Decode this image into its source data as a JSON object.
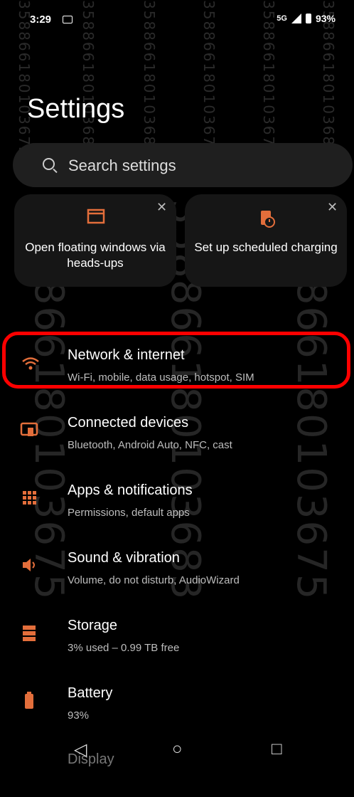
{
  "status_bar": {
    "time": "3:29",
    "network": "5G",
    "battery": "93%"
  },
  "page": {
    "title": "Settings"
  },
  "search": {
    "placeholder": "Search settings"
  },
  "suggestions": [
    {
      "label": "Open floating windows via heads-ups"
    },
    {
      "label": "Set up scheduled charging"
    }
  ],
  "items": [
    {
      "title": "Network & internet",
      "subtitle": "Wi-Fi, mobile, data usage, hotspot, SIM"
    },
    {
      "title": "Connected devices",
      "subtitle": "Bluetooth, Android Auto, NFC, cast"
    },
    {
      "title": "Apps & notifications",
      "subtitle": "Permissions, default apps"
    },
    {
      "title": "Sound & vibration",
      "subtitle": "Volume, do not disturb, AudioWizard"
    },
    {
      "title": "Storage",
      "subtitle": "3% used – 0.99 TB free"
    },
    {
      "title": "Battery",
      "subtitle": "93%"
    },
    {
      "title": "Display",
      "subtitle": ""
    }
  ],
  "watermark": {
    "text": "358866180103675",
    "text2": "358866180103683"
  },
  "accent_color": "#e36e3b"
}
